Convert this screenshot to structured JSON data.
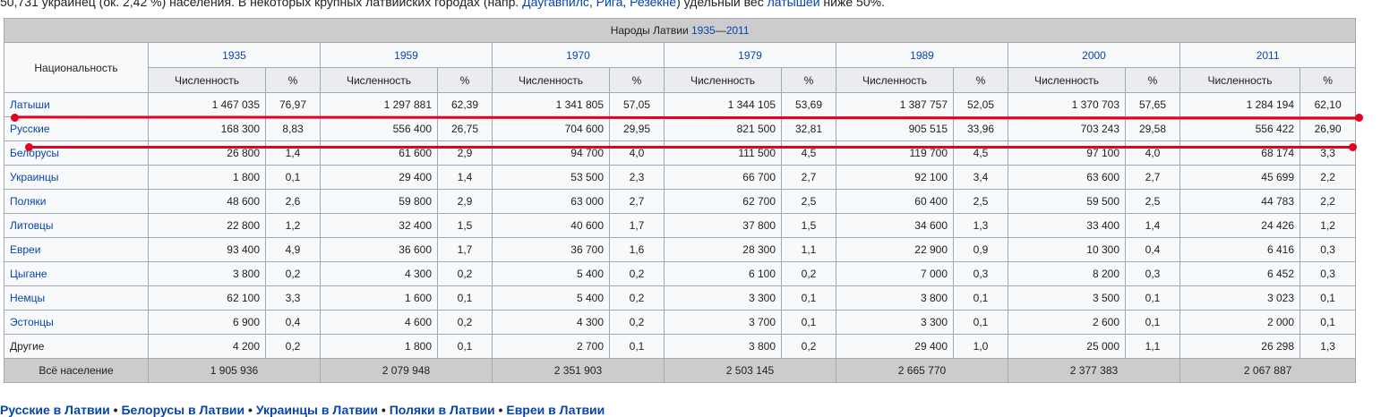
{
  "intro": {
    "before": "50,731 украинец (ок. 2,42 %) населения. В некоторых крупных латвийских городах (напр. ",
    "link1": "Даугавпилс",
    "sep1": ", ",
    "link2": "Рига",
    "sep2": ", ",
    "link3": "Резекне",
    "middle": ") удельный вес ",
    "link4": "латышей",
    "after": " ниже 50%."
  },
  "table": {
    "caption_prefix": "Народы Латвии ",
    "caption_year_start": "1935",
    "caption_dash": "—",
    "caption_year_end": "2011",
    "nationality_header": "Национальность",
    "count_header": "Численность",
    "pct_header": "%",
    "years": [
      "1935",
      "1959",
      "1970",
      "1979",
      "1989",
      "2000",
      "2011"
    ],
    "rows": [
      {
        "name": "Латыши",
        "link": true,
        "values": [
          [
            "1 467 035",
            "76,97"
          ],
          [
            "1 297 881",
            "62,39"
          ],
          [
            "1 341 805",
            "57,05"
          ],
          [
            "1 344 105",
            "53,69"
          ],
          [
            "1 387 757",
            "52,05"
          ],
          [
            "1 370 703",
            "57,65"
          ],
          [
            "1 284 194",
            "62,10"
          ]
        ]
      },
      {
        "name": "Русские",
        "link": true,
        "values": [
          [
            "168 300",
            "8,83"
          ],
          [
            "556 400",
            "26,75"
          ],
          [
            "704 600",
            "29,95"
          ],
          [
            "821 500",
            "32,81"
          ],
          [
            "905 515",
            "33,96"
          ],
          [
            "703 243",
            "29,58"
          ],
          [
            "556 422",
            "26,90"
          ]
        ]
      },
      {
        "name": "Белорусы",
        "link": true,
        "values": [
          [
            "26 800",
            "1,4"
          ],
          [
            "61 600",
            "2,9"
          ],
          [
            "94 700",
            "4,0"
          ],
          [
            "111 500",
            "4,5"
          ],
          [
            "119 700",
            "4,5"
          ],
          [
            "97 100",
            "4,0"
          ],
          [
            "68 174",
            "3,3"
          ]
        ]
      },
      {
        "name": "Украинцы",
        "link": true,
        "values": [
          [
            "1 800",
            "0,1"
          ],
          [
            "29 400",
            "1,4"
          ],
          [
            "53 500",
            "2,3"
          ],
          [
            "66 700",
            "2,7"
          ],
          [
            "92 100",
            "3,4"
          ],
          [
            "63 600",
            "2,7"
          ],
          [
            "45 699",
            "2,2"
          ]
        ]
      },
      {
        "name": "Поляки",
        "link": true,
        "values": [
          [
            "48 600",
            "2,6"
          ],
          [
            "59 800",
            "2,9"
          ],
          [
            "63 000",
            "2,7"
          ],
          [
            "62 700",
            "2,5"
          ],
          [
            "60 400",
            "2,5"
          ],
          [
            "59 500",
            "2,5"
          ],
          [
            "44 783",
            "2,2"
          ]
        ]
      },
      {
        "name": "Литовцы",
        "link": true,
        "values": [
          [
            "22 800",
            "1,2"
          ],
          [
            "32 400",
            "1,5"
          ],
          [
            "40 600",
            "1,7"
          ],
          [
            "37 800",
            "1,5"
          ],
          [
            "34 600",
            "1,3"
          ],
          [
            "33 400",
            "1,4"
          ],
          [
            "24 426",
            "1,2"
          ]
        ]
      },
      {
        "name": "Евреи",
        "link": true,
        "values": [
          [
            "93 400",
            "4,9"
          ],
          [
            "36 600",
            "1,7"
          ],
          [
            "36 700",
            "1,6"
          ],
          [
            "28 300",
            "1,1"
          ],
          [
            "22 900",
            "0,9"
          ],
          [
            "10 300",
            "0,4"
          ],
          [
            "6 416",
            "0,3"
          ]
        ]
      },
      {
        "name": "Цыгане",
        "link": true,
        "values": [
          [
            "3 800",
            "0,2"
          ],
          [
            "4 300",
            "0,2"
          ],
          [
            "5 400",
            "0,2"
          ],
          [
            "6 100",
            "0,2"
          ],
          [
            "7 000",
            "0,3"
          ],
          [
            "8 200",
            "0,3"
          ],
          [
            "6 452",
            "0,3"
          ]
        ]
      },
      {
        "name": "Немцы",
        "link": true,
        "values": [
          [
            "62 100",
            "3,3"
          ],
          [
            "1 600",
            "0,1"
          ],
          [
            "5 400",
            "0,2"
          ],
          [
            "3 300",
            "0,1"
          ],
          [
            "3 800",
            "0,1"
          ],
          [
            "3 500",
            "0,1"
          ],
          [
            "3 023",
            "0,1"
          ]
        ]
      },
      {
        "name": "Эстонцы",
        "link": true,
        "values": [
          [
            "6 900",
            "0,4"
          ],
          [
            "4 600",
            "0,2"
          ],
          [
            "4 300",
            "0,2"
          ],
          [
            "3 700",
            "0,1"
          ],
          [
            "3 300",
            "0,1"
          ],
          [
            "2 600",
            "0,1"
          ],
          [
            "2 000",
            "0,1"
          ]
        ]
      },
      {
        "name": "Другие",
        "link": false,
        "values": [
          [
            "4 200",
            "0,2"
          ],
          [
            "1 800",
            "0,1"
          ],
          [
            "2 700",
            "0,1"
          ],
          [
            "3 800",
            "0,2"
          ],
          [
            "29 400",
            "1,0"
          ],
          [
            "25 000",
            "1,1"
          ],
          [
            "26 298",
            "1,3"
          ]
        ]
      }
    ],
    "total": {
      "label": "Всё население",
      "values": [
        "1 905 936",
        "2 079 948",
        "2 351 903",
        "2 503 145",
        "2 665 770",
        "2 377 383",
        "2 067 887"
      ]
    }
  },
  "outro": {
    "link1": "Русские в Латвии",
    "link2": "Белорусы в Латвии",
    "link3": "Украинцы в Латвии",
    "link4": "Поляки в Латвии",
    "link5": "Евреи в Латвии",
    "sep": " • "
  },
  "annotation_color": "#e4001e"
}
